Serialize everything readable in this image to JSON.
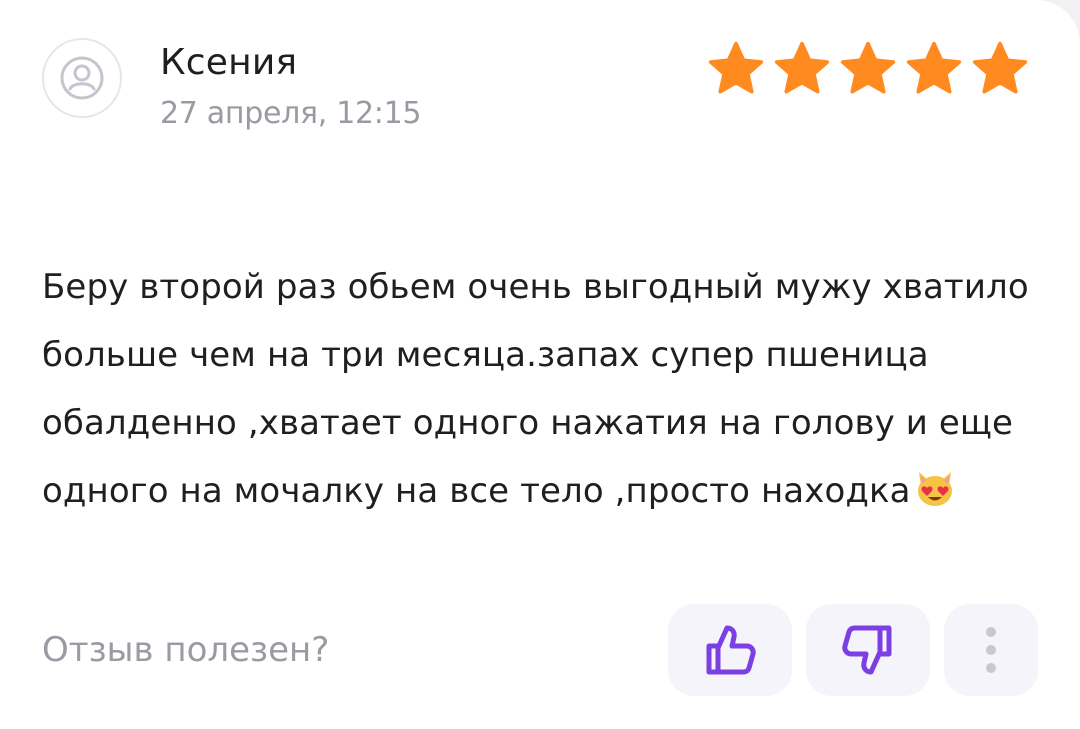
{
  "review": {
    "author": "Ксения",
    "date": "27 апреля, 12:15",
    "rating": 5,
    "rating_max": 5,
    "text": "Беру второй раз обьем очень выгодный мужу хватило больше чем на три месяца.запах супер пшеница обалденно ,хватает одного нажатия на голову и еще одного на мочалку на все тело ,просто находка",
    "emoji": "smiling-cat-heart-eyes"
  },
  "feedback": {
    "question": "Отзыв полезен?",
    "like_icon": "thumbs-up-icon",
    "dislike_icon": "thumbs-down-icon",
    "more_icon": "more-vertical-icon"
  },
  "colors": {
    "star": "#ff8a1f",
    "accent": "#7b3fe4",
    "muted_text": "#9a9aa3",
    "button_bg": "#f5f4fa"
  }
}
